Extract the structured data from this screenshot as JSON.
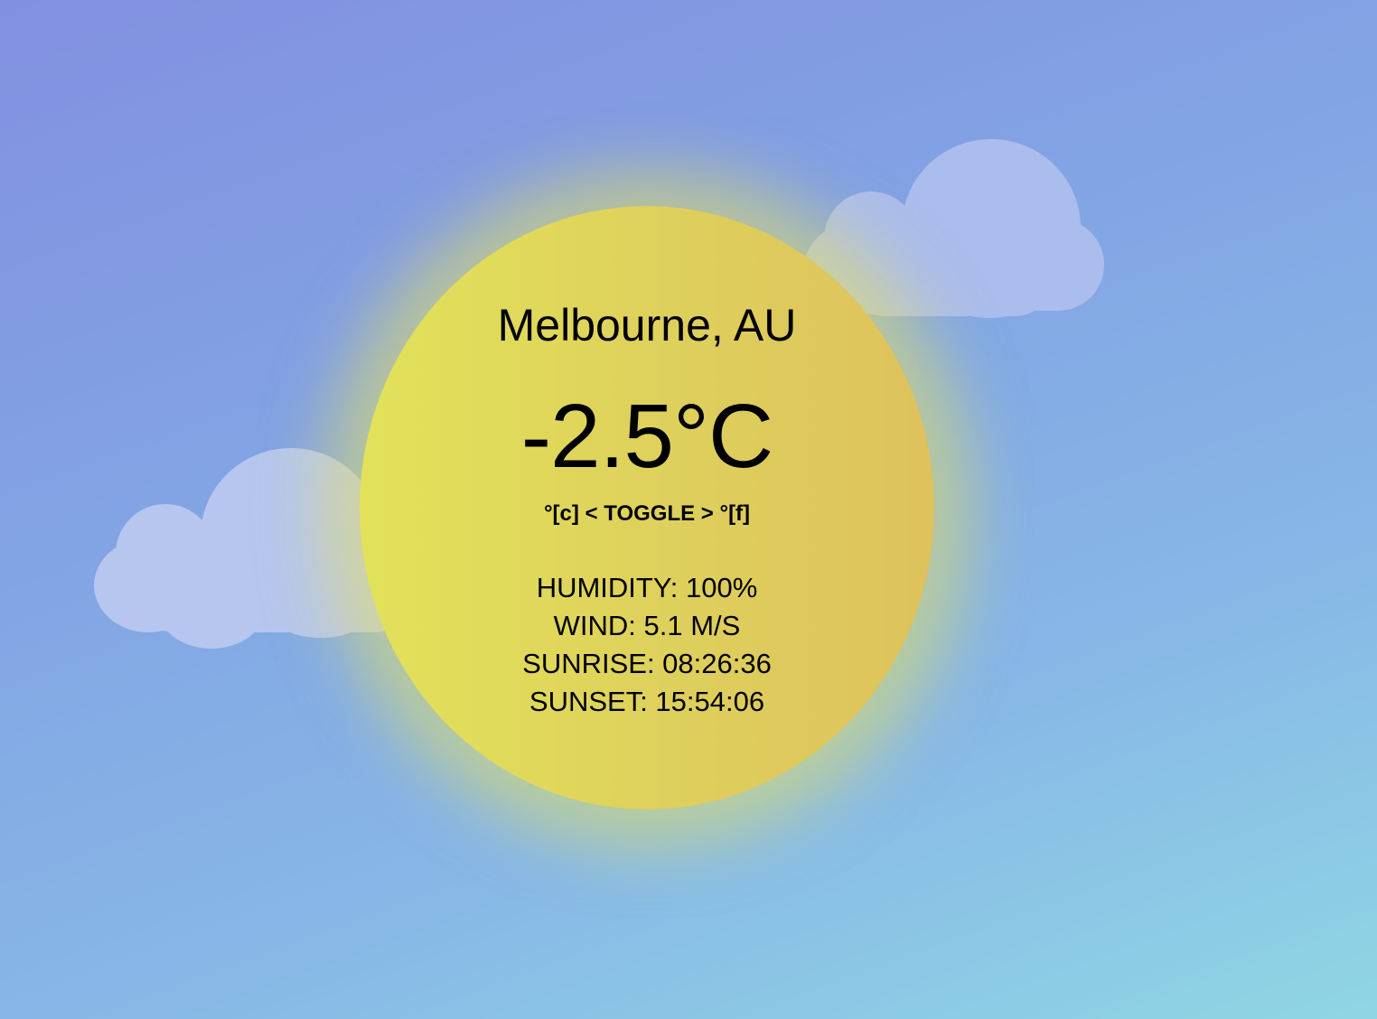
{
  "weather": {
    "location": "Melbourne, AU",
    "temperature": "-2.5°C",
    "toggle_label": "°[c] < TOGGLE > °[f]",
    "humidity": "HUMIDITY: 100%",
    "wind": "WIND: 5.1 M/S",
    "sunrise": "SUNRISE: 08:26:36",
    "sunset": "SUNSET: 15:54:06"
  },
  "colors": {
    "sky_top": "#8290e0",
    "sky_bottom": "#8fd6e4",
    "sun": "#dfd25c",
    "cloud": "#b6c6ee"
  }
}
